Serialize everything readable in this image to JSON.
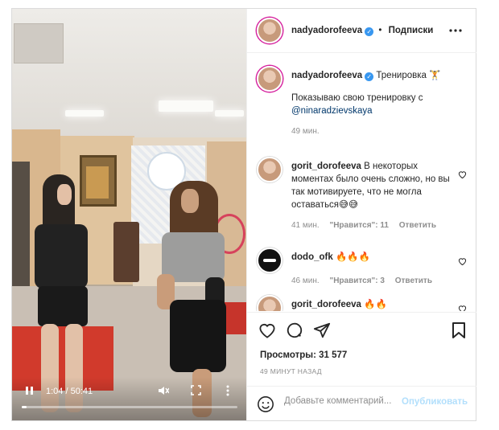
{
  "post": {
    "author": "nadyadorofeeva",
    "follow_separator": "•",
    "follow_label": "Подписки",
    "more_icon": "more-horizontal-icon"
  },
  "caption": {
    "username": "nadyadorofeeva",
    "title": "Тренировка",
    "title_emoji": "🏋",
    "text_before": "Показываю свою тренировку с",
    "mention": "@ninaradzievskaya",
    "time": "49 мин."
  },
  "comments": [
    {
      "username": "gorit_dorofeeva",
      "text": "В некоторых моментах было очень сложно, но вы так мотивируете, что не могла оставаться😅😅",
      "time": "41 мин.",
      "likes": "\"Нравится\": 11",
      "reply": "Ответить"
    },
    {
      "username": "dodo_ofk",
      "text": "🔥🔥🔥",
      "time": "46 мин.",
      "likes": "\"Нравится\": 3",
      "reply": "Ответить"
    },
    {
      "username": "gorit_dorofeeva",
      "text": "🔥🔥"
    }
  ],
  "stats": {
    "views": "Просмотры: 31 577",
    "posted_ago": "49 МИНУТ НАЗАД"
  },
  "comment_box": {
    "placeholder": "Добавьте комментарий...",
    "publish": "Опубликовать"
  },
  "video": {
    "current_time": "1:04",
    "duration": "50:41",
    "time_display": "1:04 / 50:41",
    "progress": 0.021
  },
  "colors": {
    "verified": "#3897f0",
    "publish_disabled": "#b2dffc",
    "mention": "#00376b"
  }
}
